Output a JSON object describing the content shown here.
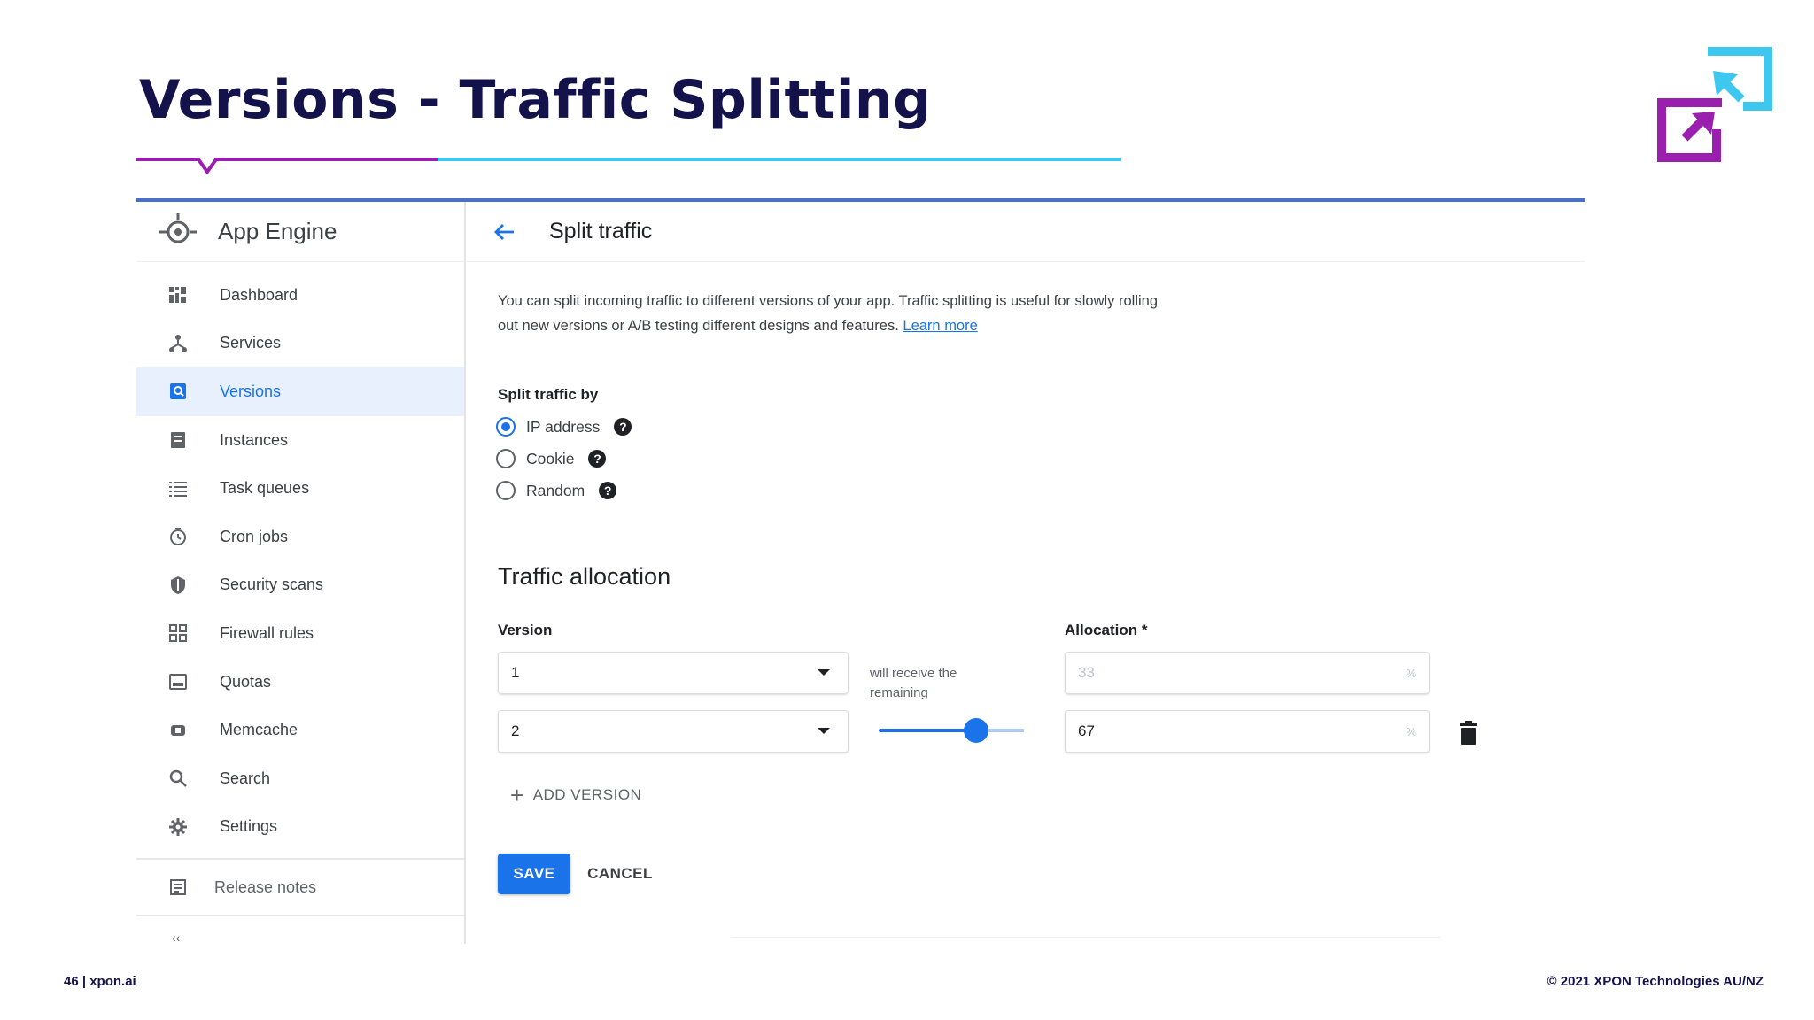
{
  "slide": {
    "title": "Versions - Traffic Splitting",
    "page_footer": "46 | xpon.ai",
    "copyright": "© 2021 XPON Technologies AU/NZ",
    "colors": {
      "title": "#14124a",
      "purple": "#9b1fae",
      "cyan": "#3ec8ef",
      "accent_blue": "#1a73e8"
    }
  },
  "sidebar": {
    "product": "App Engine",
    "items": [
      {
        "label": "Dashboard",
        "icon": "dashboard-icon"
      },
      {
        "label": "Services",
        "icon": "services-icon"
      },
      {
        "label": "Versions",
        "icon": "versions-icon",
        "active": true
      },
      {
        "label": "Instances",
        "icon": "instances-icon"
      },
      {
        "label": "Task queues",
        "icon": "task-queues-icon"
      },
      {
        "label": "Cron jobs",
        "icon": "clock-icon"
      },
      {
        "label": "Security scans",
        "icon": "shield-icon"
      },
      {
        "label": "Firewall rules",
        "icon": "firewall-icon"
      },
      {
        "label": "Quotas",
        "icon": "quotas-icon"
      },
      {
        "label": "Memcache",
        "icon": "memcache-icon"
      },
      {
        "label": "Search",
        "icon": "search-icon"
      },
      {
        "label": "Settings",
        "icon": "gear-icon"
      }
    ],
    "release_notes": "Release notes"
  },
  "main": {
    "title": "Split traffic",
    "description": "You can split incoming traffic to different versions of your app. Traffic splitting is useful for slowly rolling out new versions or A/B testing different designs and features.",
    "learn_more": "Learn more",
    "split_by_label": "Split traffic by",
    "split_options": [
      {
        "label": "IP address",
        "checked": true
      },
      {
        "label": "Cookie",
        "checked": false
      },
      {
        "label": "Random",
        "checked": false
      }
    ],
    "help_glyph": "?",
    "allocation_title": "Traffic allocation",
    "version_col": "Version",
    "allocation_col": "Allocation *",
    "rows": [
      {
        "version": "1",
        "allocation": "33",
        "percent_sign": "%",
        "note": "will receive the remaining"
      },
      {
        "version": "2",
        "allocation": "67",
        "percent_sign": "%",
        "slider_fraction": 0.67
      }
    ],
    "add_version": "ADD VERSION",
    "save": "SAVE",
    "cancel": "CANCEL"
  }
}
